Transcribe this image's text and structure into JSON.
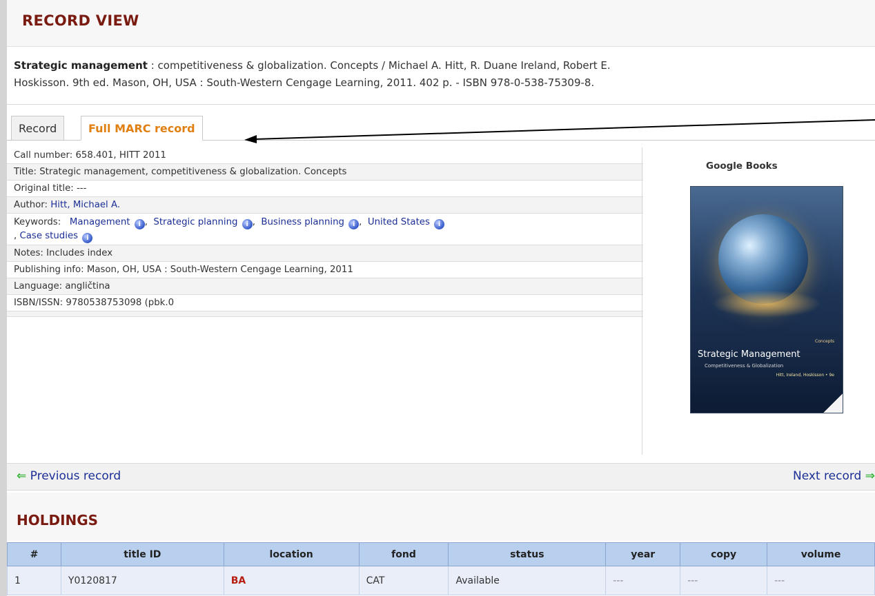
{
  "record_view": {
    "title": "RECORD VIEW",
    "citation": {
      "bold_title": "Strategic management",
      "rest_line1": " : competitiveness & globalization. Concepts / Michael A. Hitt, R. Duane Ireland, Robert E.",
      "line2": "Hoskisson. 9th ed. Mason, OH, USA : South-Western Cengage Learning, 2011. 402 p. - ISBN 978-0-538-75309-8."
    },
    "tabs": [
      {
        "label": "Record"
      },
      {
        "label": "Full MARC record"
      }
    ],
    "details": {
      "call_number": {
        "label": "Call number:",
        "value": "658.401, HITT 2011"
      },
      "title": {
        "label": "Title:",
        "value": "Strategic management, competitiveness & globalization. Concepts"
      },
      "original_title": {
        "label": "Original title:",
        "value": "---"
      },
      "author": {
        "label": "Author:",
        "value": "Hitt, Michael A."
      },
      "keywords": {
        "label": "Keywords:",
        "items": [
          "Management",
          "Strategic planning",
          "Business planning",
          "United States",
          "Case studies"
        ]
      },
      "notes": {
        "label": "Notes:",
        "value": "Includes index"
      },
      "publishing": {
        "label": "Publishing info:",
        "value": "Mason, OH, USA : South-Western Cengage Learning, 2011"
      },
      "language": {
        "label": "Language:",
        "value": "angličtina"
      },
      "isbn": {
        "label": "ISBN/ISSN:",
        "value": "9780538753098 (pbk.0"
      }
    },
    "google_books": {
      "label": "Google Books",
      "cover": {
        "small_text": "Concepts",
        "title": "Strategic Management",
        "subtitle": "Competitiveness & Globalization",
        "authors": "Hitt, Ireland, Hoskisson • 9e"
      }
    },
    "nav": {
      "prev": "Previous record",
      "next": "Next record"
    }
  },
  "holdings": {
    "title": "HOLDINGS",
    "columns": [
      "#",
      "title ID",
      "location",
      "fond",
      "status",
      "year",
      "copy",
      "volume"
    ],
    "rows": [
      [
        "1",
        "Y0120817",
        "BA",
        "CAT",
        "Available",
        "---",
        "---",
        "---"
      ]
    ]
  },
  "colors": {
    "heading": "#7a1b12",
    "link": "#1c2f96",
    "active_tab": "#e07f12",
    "location": "#b81d12",
    "table_header": "#b9cfee"
  }
}
